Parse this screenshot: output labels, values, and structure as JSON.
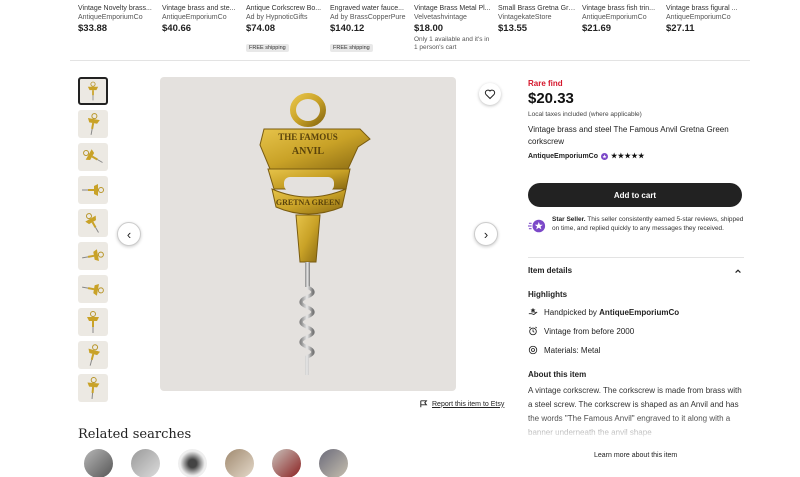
{
  "top_items": [
    {
      "title": "Vintage Novelty brass...",
      "shop": "AntiqueEmporiumCo",
      "price": "$33.88"
    },
    {
      "title": "Vintage brass and ste...",
      "shop": "AntiqueEmporiumCo",
      "price": "$40.66"
    },
    {
      "title": "Antique Corkscrew Bo...",
      "shop": "Ad by HypnoticGifts",
      "price": "$74.08",
      "badge": "FREE shipping"
    },
    {
      "title": "Engraved water fauce...",
      "shop": "Ad by BrassCopperPure",
      "price": "$140.12",
      "badge": "FREE shipping"
    },
    {
      "title": "Vintage Brass Metal Pl...",
      "shop": "Velvetashvintage",
      "price": "$18.00",
      "note": "Only 1 available and it's in 1 person's cart"
    },
    {
      "title": "Small Brass Gretna Gre...",
      "shop": "VintagekateStore",
      "price": "$13.55"
    },
    {
      "title": "Vintage brass fish trin...",
      "shop": "AntiqueEmporiumCo",
      "price": "$21.69"
    },
    {
      "title": "Vintage brass figural ...",
      "shop": "AntiqueEmporiumCo",
      "price": "$27.11"
    }
  ],
  "product": {
    "rare": "Rare find",
    "price": "$20.33",
    "tax": "Local taxes included (where applicable)",
    "title": "Vintage brass and steel The Famous Anvil Gretna Green corkscrew",
    "seller": "AntiqueEmporiumCo",
    "stars": "★★★★★",
    "cart_label": "Add to cart",
    "star_seller_label": "Star Seller.",
    "star_seller_text": " This seller consistently earned 5-star reviews, shipped on time, and replied quickly to any messages they received."
  },
  "details": {
    "heading": "Item details",
    "highlights_title": "Highlights",
    "handpicked_prefix": "Handpicked by ",
    "handpicked_shop": "AntiqueEmporiumCo",
    "vintage": "Vintage from before 2000",
    "materials": "Materials: Metal",
    "about_title": "About this item",
    "about_body": "A vintage corkscrew. The corkscrew is made from brass with a steel screw. The corkscrew is shaped as an Anvil and has the words \"The Famous Anvil\" engraved to it along with a banner underneath the anvil shape",
    "learn_more": "Learn more about this item"
  },
  "image_text": {
    "line1": "THE FAMOUS",
    "line2": "ANVIL",
    "banner": "GRETNA GREEN"
  },
  "report_label": "Report this item to Etsy",
  "related_title": "Related searches",
  "nav": {
    "prev": "‹",
    "next": "›"
  },
  "colors": {
    "accent": "#d5162b",
    "button": "#222222",
    "brass": "#c9a227"
  }
}
